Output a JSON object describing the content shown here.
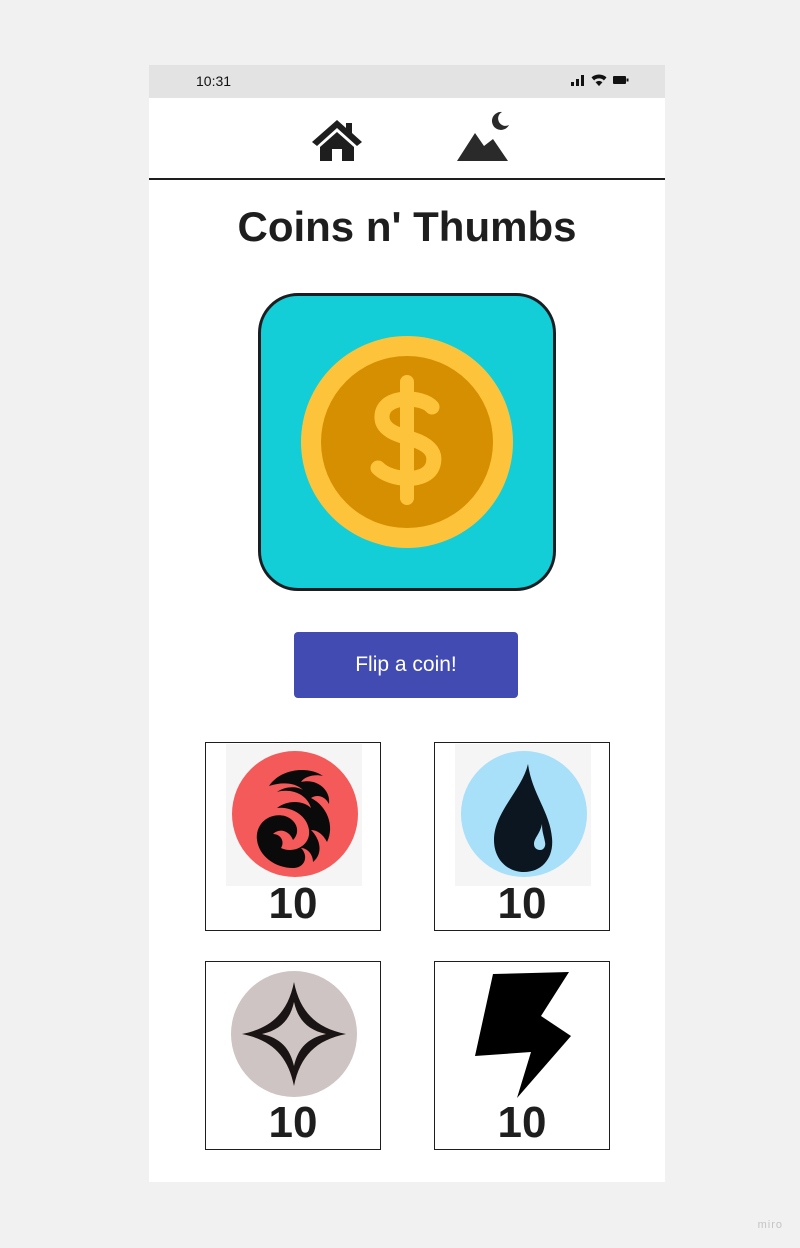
{
  "status_bar": {
    "time": "10:31"
  },
  "app": {
    "title": "Coins n' Thumbs"
  },
  "nav": [
    {
      "name": "home",
      "icon": "home-icon"
    },
    {
      "name": "theme",
      "icon": "mountain-moon-icon"
    }
  ],
  "coin": {
    "icon": "dollar-coin-icon",
    "background": "#13ced6"
  },
  "flip_button": {
    "label": "Flip a coin!",
    "color": "#424bb2"
  },
  "counters": [
    {
      "icon": "fire-mana-icon",
      "count": "10",
      "color": "#f45a59"
    },
    {
      "icon": "water-drop-mana-icon",
      "count": "10",
      "color": "#a8dff9"
    },
    {
      "icon": "colorless-diamond-mana-icon",
      "count": "10",
      "color": "#cdc4c3"
    },
    {
      "icon": "lightning-bolt-icon",
      "count": "10",
      "color": "#000000"
    }
  ],
  "watermark": "miro"
}
